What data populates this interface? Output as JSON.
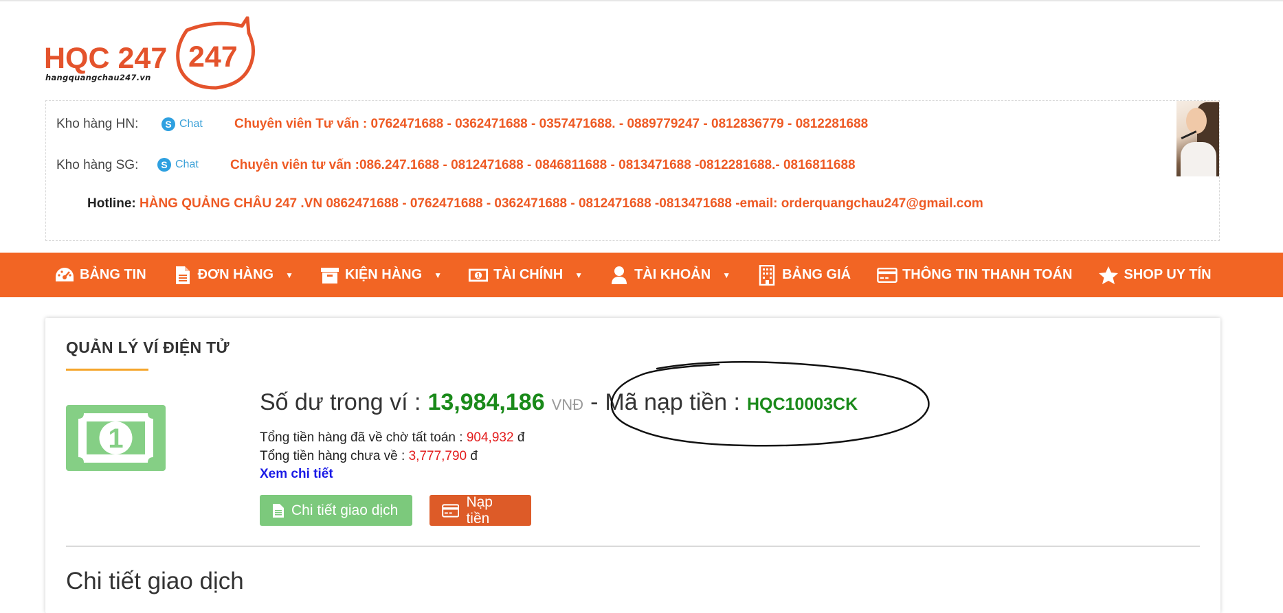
{
  "logo": {
    "name": "HQC 247",
    "badge": "247",
    "domain": "hangquangchau247.vn"
  },
  "info": {
    "rows": [
      {
        "label": "Kho hàng HN:",
        "chat": "Chat",
        "consultant": "Chuyên viên Tư vấn : 0762471688 - 0362471688 - 0357471688. - 0889779247 - 0812836779 - 0812281688"
      },
      {
        "label": "Kho hàng SG:",
        "chat": "Chat",
        "consultant": "Chuyên viên tư vấn :086.247.1688 - 0812471688 - 0846811688 - 0813471688 -0812281688.- 0816811688"
      }
    ],
    "hotline_label": "Hotline:",
    "hotline_value": "HÀNG QUẢNG CHÂU 247 .VN 0862471688 - 0762471688 - 0362471688 - 0812471688 -0813471688 -email: orderquangchau247@gmail.com"
  },
  "nav": {
    "items": [
      {
        "label": "BẢNG TIN",
        "icon": "dashboard-icon",
        "dropdown": false
      },
      {
        "label": "ĐƠN HÀNG",
        "icon": "document-icon",
        "dropdown": true
      },
      {
        "label": "KIỆN HÀNG",
        "icon": "archive-icon",
        "dropdown": true
      },
      {
        "label": "TÀI CHÍNH",
        "icon": "money-icon",
        "dropdown": true
      },
      {
        "label": "TÀI KHOẢN",
        "icon": "user-icon",
        "dropdown": true
      },
      {
        "label": "BẢNG GIÁ",
        "icon": "building-icon",
        "dropdown": false
      },
      {
        "label": "THÔNG TIN THANH TOÁN",
        "icon": "credit-card-icon",
        "dropdown": false
      },
      {
        "label": "SHOP UY TÍN",
        "icon": "star-icon",
        "dropdown": false
      }
    ]
  },
  "wallet": {
    "title": "QUẢN LÝ VÍ ĐIỆN TỬ",
    "balance_label": "Số dư trong ví :",
    "balance_value": "13,984,186",
    "balance_unit": "VNĐ",
    "separator": "-",
    "code_label": "Mã nạp tiền :",
    "code_value": "HQC10003CK",
    "pending_label": "Tổng tiền hàng đã về chờ tất toán :",
    "pending_value": "904,932",
    "pending_unit": "đ",
    "not_arrived_label": "Tổng tiền hàng chưa về :",
    "not_arrived_value": "3,777,790",
    "not_arrived_unit": "đ",
    "detail_link": "Xem chi tiết",
    "btn_transactions": "Chi tiết giao dịch",
    "btn_deposit": "Nạp tiền",
    "section_title": "Chi tiết giao dịch"
  },
  "colors": {
    "brand_orange": "#f26524",
    "accent_green": "#1a8a1a",
    "button_green": "#7cc97c",
    "button_orange": "#dd5b28",
    "link_blue": "#1a1ae6",
    "value_red": "#e31c1c"
  }
}
